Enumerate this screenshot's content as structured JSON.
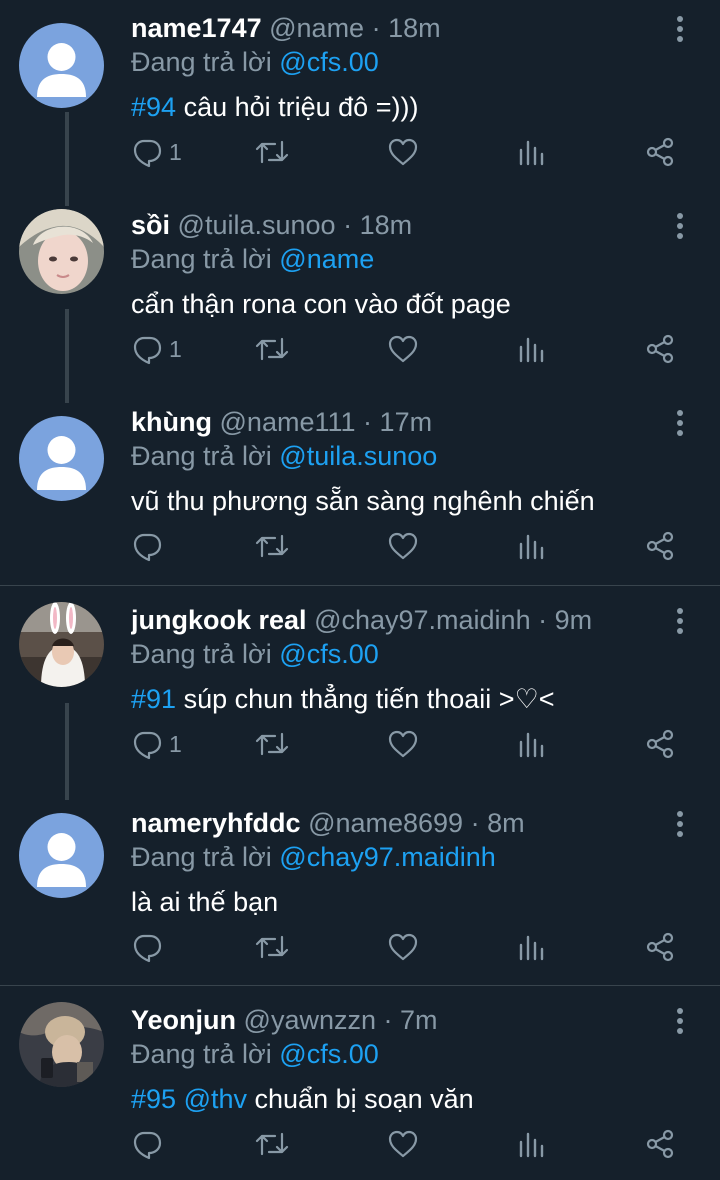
{
  "colors": {
    "background": "#15202b",
    "divider": "#38444d",
    "link": "#1da1f2",
    "muted": "#8899a6",
    "default_avatar": "#7ba3de"
  },
  "replies": [
    {
      "name": "name1747",
      "handle": "@name",
      "dot": "·",
      "time": "18m",
      "reply_prefix": "Đang trả lời",
      "reply_to": "@cfs.00",
      "hashtag": "#94",
      "text": " câu hỏi triệu đô =)))",
      "reply_count": "1",
      "avatar": "default-avatar-icon"
    },
    {
      "name": "sồi",
      "handle": "@tuila.sunoo",
      "dot": "·",
      "time": "18m",
      "reply_prefix": "Đang trả lời",
      "reply_to": "@name",
      "text": "cẩn thận rona con vào đốt page",
      "reply_count": "1",
      "avatar": "photo-avatar"
    },
    {
      "name": "khùng",
      "handle": "@name111",
      "dot": "·",
      "time": "17m",
      "reply_prefix": "Đang trả lời",
      "reply_to": "@tuila.sunoo",
      "text": "vũ thu phương sẵn sàng nghênh chiến",
      "reply_count": "",
      "avatar": "default-avatar-icon"
    },
    {
      "name": "jungkook real",
      "handle": "@chay97.maidinh",
      "dot": "·",
      "time": "9m",
      "reply_prefix": "Đang trả lời",
      "reply_to": "@cfs.00",
      "hashtag": "#91",
      "text": " súp chun thẳng tiến thoaii >♡<",
      "reply_count": "1",
      "avatar": "photo-avatar"
    },
    {
      "name": "nameryhfddc",
      "handle": "@name8699",
      "dot": "·",
      "time": "8m",
      "reply_prefix": "Đang trả lời",
      "reply_to": "@chay97.maidinh",
      "text": "là ai thế bạn",
      "reply_count": "",
      "avatar": "default-avatar-icon"
    },
    {
      "name": "Yeonjun",
      "handle": "@yawnzzn",
      "dot": "·",
      "time": "7m",
      "reply_prefix": "Đang trả lời",
      "reply_to": "@cfs.00",
      "hashtag": "#95",
      "mention": "@thv",
      "text": " chuẩn bị soạn văn",
      "reply_count": "",
      "avatar": "photo-avatar"
    }
  ],
  "icons": {
    "reply": "reply-icon",
    "retweet": "retweet-icon",
    "like": "heart-icon",
    "analytics": "analytics-icon",
    "share": "share-icon",
    "more": "more-vertical-icon"
  }
}
